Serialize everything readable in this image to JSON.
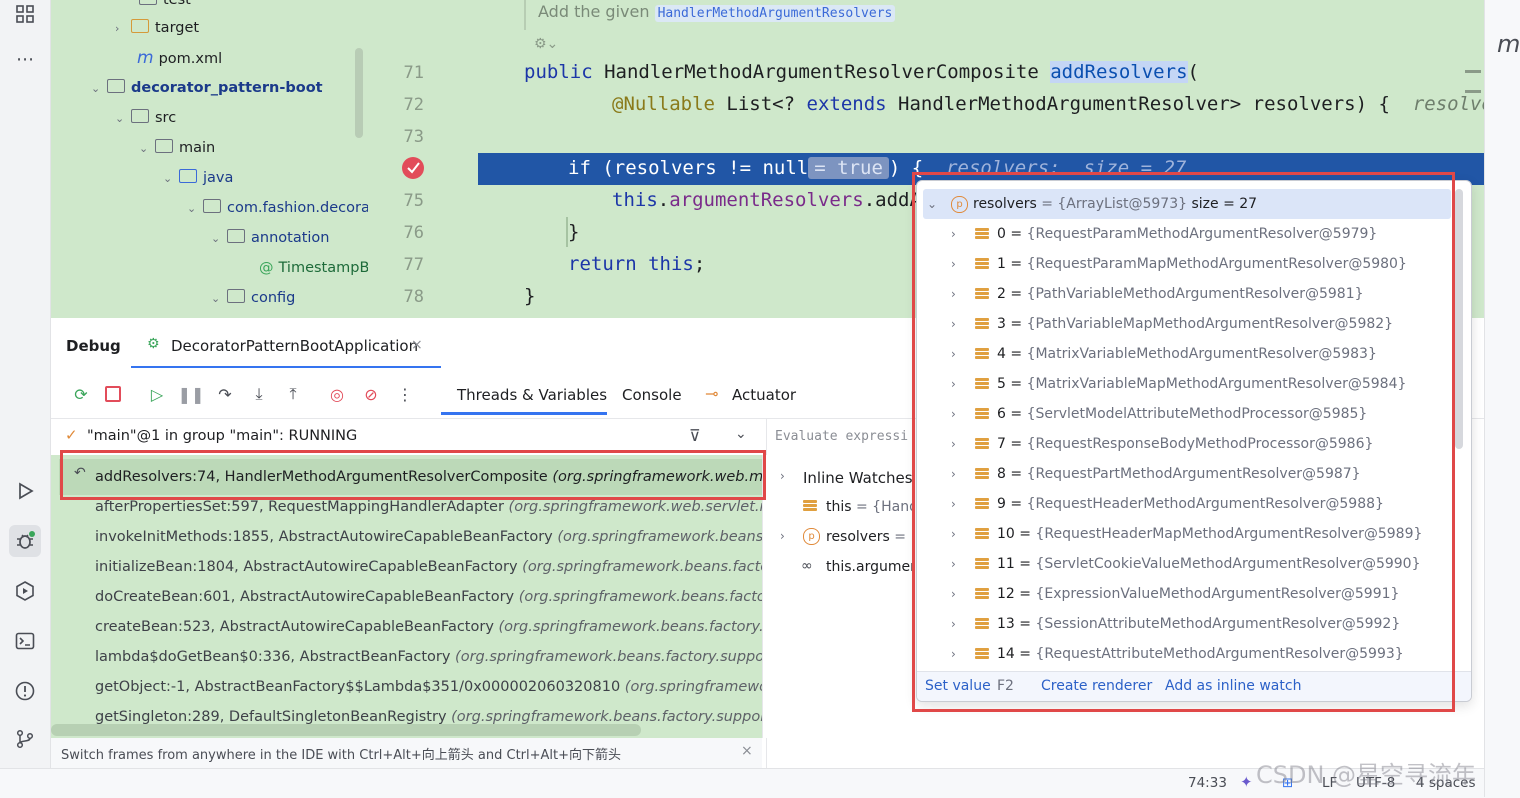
{
  "project_tree": {
    "items": [
      {
        "label": "test",
        "depth": 3
      },
      {
        "label": "target",
        "depth": 2
      },
      {
        "label": "pom.xml",
        "depth": 2
      },
      {
        "label": "decorator_pattern-boot",
        "depth": 1
      },
      {
        "label": "src",
        "depth": 2
      },
      {
        "label": "main",
        "depth": 3
      },
      {
        "label": "java",
        "depth": 4
      },
      {
        "label": "com.fashion.decorat",
        "depth": 5
      },
      {
        "label": "annotation",
        "depth": 6
      },
      {
        "label": "TimestampBc",
        "depth": 7
      },
      {
        "label": "config",
        "depth": 6
      }
    ]
  },
  "editor": {
    "hint_text": "Add the given",
    "hint_code": "HandlerMethodArgumentResolvers",
    "lines": [
      "71",
      "72",
      "73",
      "",
      "75",
      "76",
      "77",
      "78"
    ],
    "code_71_kw": "public",
    "code_71_type": "HandlerMethodArgumentResolverComposite",
    "code_71_fn": "addResolvers",
    "code_71_paren": "(",
    "code_72_ann": "@Nullable",
    "code_72_a": "List<?",
    "code_72_kw": "extends",
    "code_72_b": "HandlerMethodArgumentResolver> resolvers) {",
    "code_72_hint": "resolvers",
    "code_74_kw": "if",
    "code_74_a": "(resolvers != null",
    "code_74_pill": "= true",
    "code_74_b": ") {",
    "code_74_hint": "resolvers:  size = 27",
    "code_75_kw": "this",
    "code_75_fn": "argumentResolvers",
    "code_75_b": ".addA",
    "code_76": "}",
    "code_77_kw": "return",
    "code_77_kw2": "this",
    "code_77_b": ";",
    "code_78": "}"
  },
  "debug": {
    "title": "Debug",
    "session_tab": "DecoratorPatternBootApplication",
    "tabs": [
      "Threads & Variables",
      "Console",
      "Actuator"
    ],
    "thread_status": "\"main\"@1 in group \"main\": RUNNING",
    "evaluate_placeholder": "Evaluate expressi",
    "frames": [
      {
        "method": "addResolvers:74, HandlerMethodArgumentResolverComposite",
        "pkg": "(org.springframework.web.method.su"
      },
      {
        "method": "afterPropertiesSet:597, RequestMappingHandlerAdapter",
        "pkg": "(org.springframework.web.servlet.mvc.meth"
      },
      {
        "method": "invokeInitMethods:1855, AbstractAutowireCapableBeanFactory",
        "pkg": "(org.springframework.beans.factory."
      },
      {
        "method": "initializeBean:1804, AbstractAutowireCapableBeanFactory",
        "pkg": "(org.springframework.beans.factory.supp"
      },
      {
        "method": "doCreateBean:601, AbstractAutowireCapableBeanFactory",
        "pkg": "(org.springframework.beans.factory.suppo"
      },
      {
        "method": "createBean:523, AbstractAutowireCapableBeanFactory",
        "pkg": "(org.springframework.beans.factory.support)"
      },
      {
        "method": "lambda$doGetBean$0:336, AbstractBeanFactory",
        "pkg": "(org.springframework.beans.factory.support)"
      },
      {
        "method": "getObject:-1, AbstractBeanFactory$$Lambda$351/0x000002060320810",
        "pkg": "(org.springframework.beans"
      },
      {
        "method": "getSingleton:289, DefaultSingletonBeanRegistry",
        "pkg": "(org.springframework.beans.factory.support)"
      }
    ],
    "inline_watches_title": "Inline Watches",
    "watches": [
      {
        "name": "this",
        "value": "= {Hand"
      },
      {
        "name": "resolvers",
        "value": "= {A"
      },
      {
        "name": "this.argumen",
        "value": ""
      }
    ],
    "hint_bar": "Switch frames from anywhere in the IDE with Ctrl+Alt+向上箭头 and Ctrl+Alt+向下箭头"
  },
  "popup": {
    "root_name": "resolvers",
    "root_value": "= {ArrayList@5973}",
    "root_size": "size = 27",
    "items": [
      {
        "idx": "0",
        "value": "{RequestParamMethodArgumentResolver@5979}"
      },
      {
        "idx": "1",
        "value": "{RequestParamMapMethodArgumentResolver@5980}"
      },
      {
        "idx": "2",
        "value": "{PathVariableMethodArgumentResolver@5981}"
      },
      {
        "idx": "3",
        "value": "{PathVariableMapMethodArgumentResolver@5982}"
      },
      {
        "idx": "4",
        "value": "{MatrixVariableMethodArgumentResolver@5983}"
      },
      {
        "idx": "5",
        "value": "{MatrixVariableMapMethodArgumentResolver@5984}"
      },
      {
        "idx": "6",
        "value": "{ServletModelAttributeMethodProcessor@5985}"
      },
      {
        "idx": "7",
        "value": "{RequestResponseBodyMethodProcessor@5986}"
      },
      {
        "idx": "8",
        "value": "{RequestPartMethodArgumentResolver@5987}"
      },
      {
        "idx": "9",
        "value": "{RequestHeaderMethodArgumentResolver@5988}"
      },
      {
        "idx": "10",
        "value": "{RequestHeaderMapMethodArgumentResolver@5989}"
      },
      {
        "idx": "11",
        "value": "{ServletCookieValueMethodArgumentResolver@5990}"
      },
      {
        "idx": "12",
        "value": "{ExpressionValueMethodArgumentResolver@5991}"
      },
      {
        "idx": "13",
        "value": "{SessionAttributeMethodArgumentResolver@5992}"
      },
      {
        "idx": "14",
        "value": "{RequestAttributeMethodArgumentResolver@5993}"
      }
    ],
    "set_value": "Set value",
    "set_value_key": "F2",
    "create_renderer": "Create renderer",
    "add_inline_watch": "Add as inline watch"
  },
  "status": {
    "position": "74:33",
    "line_sep": "LF",
    "encoding": "UTF-8",
    "indent": "4 spaces",
    "watermark": "CSDN @星空寻流年"
  },
  "colors": {
    "editor_bg": "#cfe8cb",
    "exec_line": "#2156a6",
    "highlight_box": "#e04848",
    "link": "#2c61c8"
  }
}
